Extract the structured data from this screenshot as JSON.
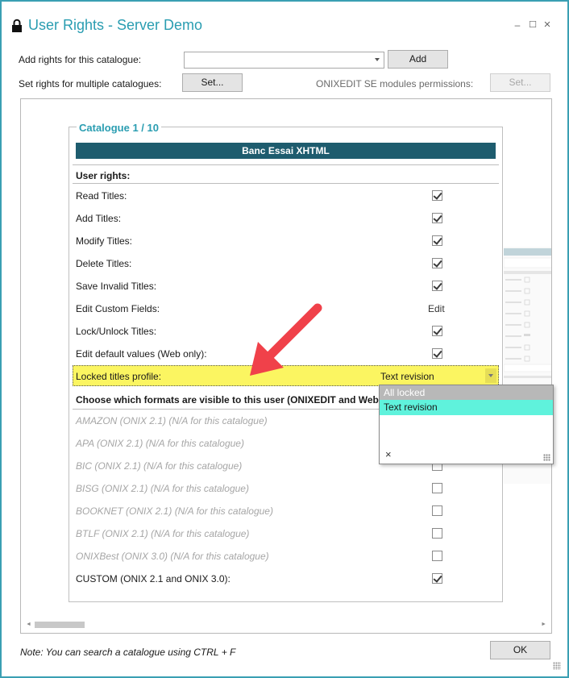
{
  "window": {
    "title": "User Rights - Server Demo",
    "minimize_glyph": "–",
    "maximize_glyph": "☐",
    "close_glyph": "×"
  },
  "top": {
    "add_rights_label": "Add rights for this catalogue:",
    "catalogue_select_value": "",
    "add_button": "Add",
    "multi_label": "Set rights for multiple catalogues:",
    "multi_button": "Set...",
    "modules_label": "ONIXEDIT SE modules permissions:",
    "modules_button": "Set..."
  },
  "catalogue": {
    "group_title": "Catalogue 1 / 10",
    "name": "Banc Essai XHTML",
    "user_rights_heading": "User rights:",
    "rights": [
      {
        "label": "Read Titles:",
        "checked": true
      },
      {
        "label": "Add Titles:",
        "checked": true
      },
      {
        "label": "Modify Titles:",
        "checked": true
      },
      {
        "label": "Delete Titles:",
        "checked": true
      },
      {
        "label": "Save Invalid Titles:",
        "checked": true
      },
      {
        "label": "Edit Custom Fields:",
        "value": "Edit"
      },
      {
        "label": "Lock/Unlock Titles:",
        "checked": true
      },
      {
        "label": "Edit default values (Web only):",
        "checked": true
      }
    ],
    "locked_profile": {
      "label": "Locked titles profile:",
      "value": "Text revision",
      "options": [
        "All locked",
        "Text revision"
      ],
      "selected": "Text revision",
      "clear_glyph": "×"
    },
    "formats_heading": "Choose which formats are visible to this user (ONIXEDIT and Web):",
    "formats": [
      {
        "label": "AMAZON (ONIX 2.1) (N/A for this catalogue)",
        "enabled": false,
        "checked": false
      },
      {
        "label": "APA (ONIX 2.1) (N/A for this catalogue)",
        "enabled": false,
        "checked": false
      },
      {
        "label": "BIC (ONIX 2.1) (N/A for this catalogue)",
        "enabled": false,
        "checked": false
      },
      {
        "label": "BISG (ONIX 2.1) (N/A for this catalogue)",
        "enabled": false,
        "checked": false
      },
      {
        "label": "BOOKNET (ONIX 2.1) (N/A for this catalogue)",
        "enabled": false,
        "checked": false
      },
      {
        "label": "BTLF (ONIX 2.1) (N/A for this catalogue)",
        "enabled": false,
        "checked": false
      },
      {
        "label": "ONIXBest (ONIX 3.0) (N/A for this catalogue)",
        "enabled": false,
        "checked": false
      },
      {
        "label": "CUSTOM (ONIX 2.1 and ONIX 3.0):",
        "enabled": true,
        "checked": true
      }
    ]
  },
  "footer": {
    "note": "Note: You can search a catalogue using CTRL + F",
    "ok_button": "OK"
  },
  "colors": {
    "accent": "#2a9db1",
    "header_bar": "#1e5c6e",
    "highlight_row": "#fbf561",
    "selected_option": "#5ff2dc",
    "annotation_arrow": "#f0414a"
  },
  "icons": {
    "title_icon": "lock-icon",
    "dropdown_icon": "chevron-down-icon"
  }
}
